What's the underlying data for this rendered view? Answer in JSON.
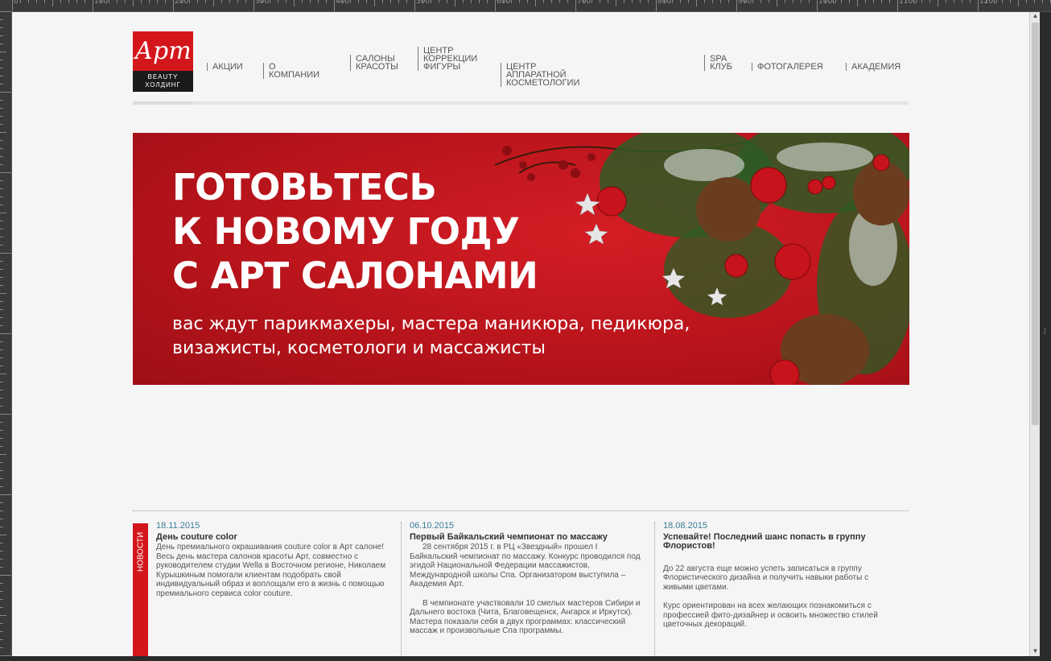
{
  "logo": {
    "brand": "Арт",
    "line1": "BEAUTY",
    "line2": "ХОЛДИНГ"
  },
  "nav": {
    "items": [
      {
        "label": "Акции"
      },
      {
        "label": "О компании"
      },
      {
        "label": "Салоны\nкрасоты"
      },
      {
        "label": "Центр\nкоррекции\nфигуры"
      },
      {
        "label": "Центр аппаратной косметологии"
      },
      {
        "label": "SPA\nклуб"
      },
      {
        "label": "Фотогалерея"
      },
      {
        "label": "Академия"
      }
    ]
  },
  "banner": {
    "headline_1": "ГОТОВЬТЕСЬ",
    "headline_2": "К НОВОМУ ГОДУ",
    "headline_3": "С АРТ САЛОНАМИ",
    "sub_1": "вас ждут парикмахеры, мастера маникюра, педикюра,",
    "sub_2": "визажисты, косметологи и массажисты"
  },
  "news": {
    "tab_label": "НОВОСТИ",
    "items": [
      {
        "date": "18.11.2015",
        "title": "День couture color",
        "body": "День премиального окрашивания couture color в Арт салоне! Весь день мастера салонов красоты Арт, совместно с руководителем студии Wella в Восточном регионе, Николаем Курышкиным помогали клиентам подобрать свой индивидуальный образ и воплощали его в жизнь с помощью премиального сервиса color couture."
      },
      {
        "date": "06.10.2015",
        "title": "Первый Байкальский чемпионат по массажу",
        "body": "28 сентября 2015 г. в РЦ «Звездный» прошел I Байкальский чемпионат по массажу. Конкурс проводился под эгидой Национальной Федерации массажистов, Международной школы Спа. Организатором выступила – Академия Арт.",
        "body2": "В чемпионате участвовали 10 смелых мастеров Сибири и Дальнего востока (Чита, Благовещенск, Ангарск и Иркутск). Мастера показали себя в двух программах: классический массаж и произвольные Спа программы."
      },
      {
        "date": "18.08.2015",
        "title": "Успевайте! Последний шанс попасть в группу Флористов!",
        "body": "До 22 августа еще можно успеть записаться в группу Флористического дизайна и получить навыки работы с живыми цветами.",
        "body2": "Курс ориентирован на всех желающих познакомиться с профессией фито-дизайнер и освоить множество стилей цветочных декораций."
      }
    ]
  },
  "colors": {
    "brand_red": "#d3161c",
    "date_blue": "#3a7b9a",
    "page_bg": "#f5f5f5"
  },
  "ruler": {
    "labels": [
      "0",
      "100",
      "200",
      "300",
      "400",
      "500",
      "600",
      "700",
      "800",
      "900",
      "1000",
      "1100",
      "1200"
    ]
  }
}
